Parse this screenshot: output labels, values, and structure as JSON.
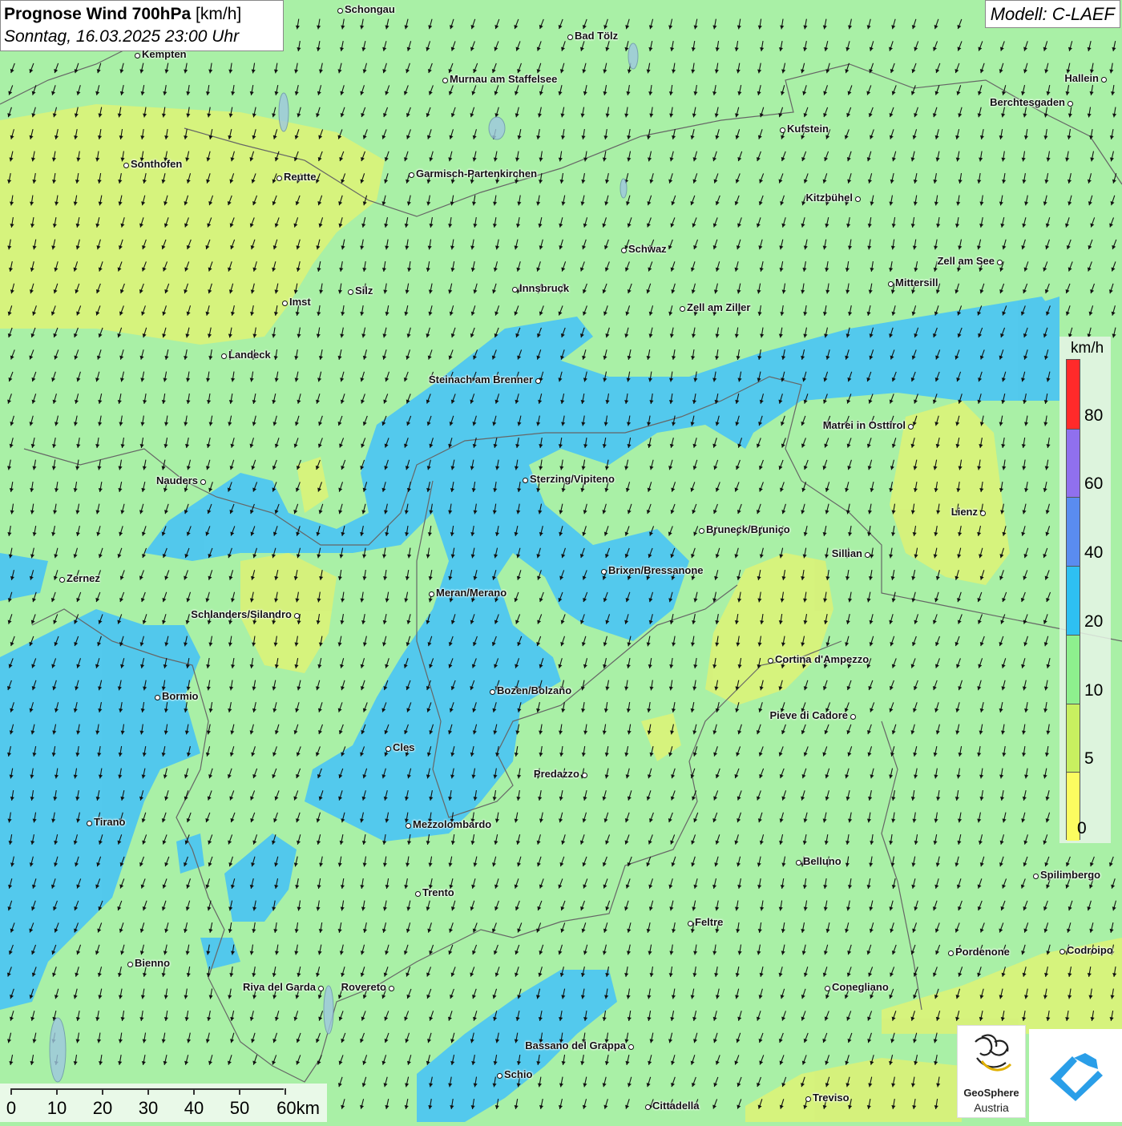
{
  "title": {
    "main": "Prognose Wind 700hPa",
    "unit": "[km/h]",
    "datetime": "Sonntag, 16.03.2025 23:00 Uhr"
  },
  "model": "Modell: C-LAEF",
  "legend": {
    "unit": "km/h",
    "labels": [
      "80",
      "60",
      "40",
      "20",
      "10",
      "5",
      "0"
    ],
    "colors": [
      "#ff2a2a",
      "#9070ee",
      "#5a8cf0",
      "#2ec0f2",
      "#8ef08e",
      "#c8f060",
      "#fcfc60"
    ]
  },
  "scale": {
    "labels": [
      "0",
      "10",
      "20",
      "30",
      "40",
      "50",
      "60km"
    ]
  },
  "logos": {
    "geosphere_line1": "GeoSphere",
    "geosphere_line2": "Austria"
  },
  "wind": {
    "direction": "north-northeast to south-southwest",
    "speed_range_kmh": [
      0,
      40
    ]
  },
  "icons": [
    "city-dot",
    "wind-arrow",
    "geosphere-logo-icon",
    "app-logo-icon"
  ],
  "cities": [
    {
      "name": "Schongau"
    },
    {
      "name": "Bad Tölz"
    },
    {
      "name": "Kempten"
    },
    {
      "name": "Murnau am Staffelsee"
    },
    {
      "name": "Hallein"
    },
    {
      "name": "Berchtesgaden"
    },
    {
      "name": "Kufstein"
    },
    {
      "name": "Sonthofen"
    },
    {
      "name": "Reutte"
    },
    {
      "name": "Garmisch-Partenkirchen"
    },
    {
      "name": "Kitzbühel"
    },
    {
      "name": "Schwaz"
    },
    {
      "name": "Zell am See"
    },
    {
      "name": "Mittersill"
    },
    {
      "name": "Silz"
    },
    {
      "name": "Innsbruck"
    },
    {
      "name": "Imst"
    },
    {
      "name": "Zell am Ziller"
    },
    {
      "name": "Landeck"
    },
    {
      "name": "Steinach am Brenner"
    },
    {
      "name": "Matrei in Osttirol"
    },
    {
      "name": "Nauders"
    },
    {
      "name": "Sterzing/Vipiteno"
    },
    {
      "name": "Lienz"
    },
    {
      "name": "Bruneck/Brunico"
    },
    {
      "name": "Sillian"
    },
    {
      "name": "Zernez"
    },
    {
      "name": "Brixen/Bressanone"
    },
    {
      "name": "Meran/Merano"
    },
    {
      "name": "Schlanders/Silandro"
    },
    {
      "name": "Cortina d'Ampezzo"
    },
    {
      "name": "Bozen/Bolzano"
    },
    {
      "name": "Bormio"
    },
    {
      "name": "Pieve di Cadore"
    },
    {
      "name": "Cles"
    },
    {
      "name": "Predazzo"
    },
    {
      "name": "Tirano"
    },
    {
      "name": "Mezzolombardo"
    },
    {
      "name": "Belluno"
    },
    {
      "name": "Spilimbergo"
    },
    {
      "name": "Trento"
    },
    {
      "name": "Feltre"
    },
    {
      "name": "Pordenone"
    },
    {
      "name": "Codroipo"
    },
    {
      "name": "Bienno"
    },
    {
      "name": "Riva del Garda"
    },
    {
      "name": "Rovereto"
    },
    {
      "name": "Conegliano"
    },
    {
      "name": "Bassano del Grappa"
    },
    {
      "name": "Schio"
    },
    {
      "name": "Treviso"
    },
    {
      "name": "Cittadella"
    }
  ]
}
